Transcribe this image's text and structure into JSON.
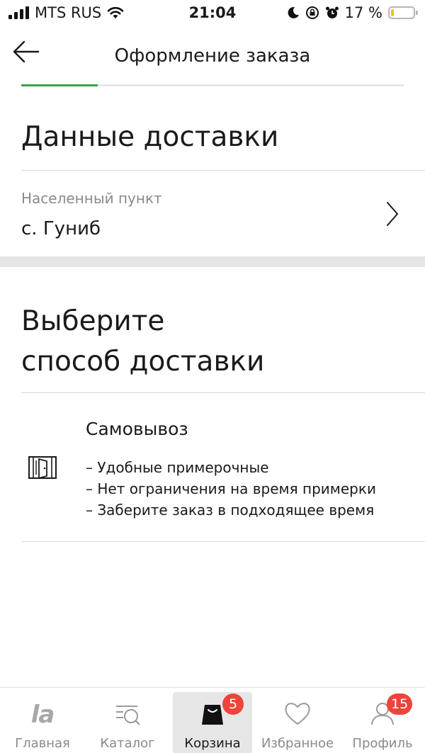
{
  "status_bar": {
    "carrier": "MTS RUS",
    "time": "21:04",
    "battery_percent": "17 %",
    "battery_level": 0.17,
    "icons": [
      "signal-icon",
      "wifi-icon",
      "moon-icon",
      "orientation-lock-icon",
      "alarm-icon",
      "battery-icon"
    ]
  },
  "header": {
    "title": "Оформление заказа",
    "back_icon": "arrow-left-icon",
    "progress": 0.2
  },
  "delivery_data": {
    "title": "Данные доставки",
    "locality": {
      "label": "Населенный пункт",
      "value": "с. Гуниб"
    }
  },
  "delivery_method": {
    "title_line1": "Выберите",
    "title_line2": "способ доставки",
    "options": [
      {
        "icon": "store-door-icon",
        "title": "Самовывоз",
        "features": [
          "– Удобные примерочные",
          "– Нет ограничения на время примерки",
          "– Заберите заказ в подходящее время"
        ]
      }
    ]
  },
  "tab_bar": {
    "tabs": [
      {
        "label": "Главная",
        "icon": "la-logo-icon"
      },
      {
        "label": "Каталог",
        "icon": "catalog-search-icon"
      },
      {
        "label": "Корзина",
        "icon": "shopping-bag-icon",
        "badge": "5",
        "active": true
      },
      {
        "label": "Избранное",
        "icon": "heart-icon"
      },
      {
        "label": "Профиль",
        "icon": "profile-icon",
        "badge": "15"
      }
    ],
    "logo_text": "la",
    "accent_color": "#36a54a",
    "badge_color": "#f0433a"
  }
}
